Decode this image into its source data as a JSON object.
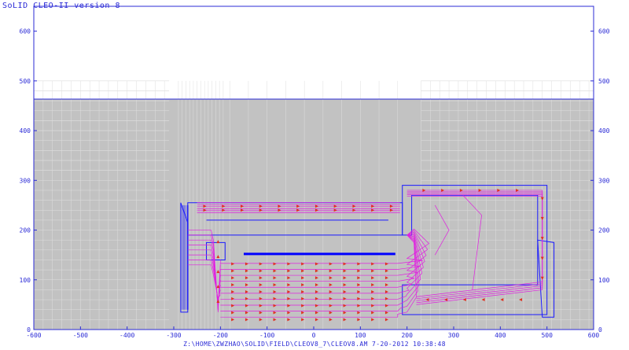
{
  "window": {
    "title": "SoLID CLEO-II version 8",
    "footer": "Z:\\HOME\\ZWZHAO\\SOLID\\FIELD\\CLEOV8_7\\CLEOV8.AM  7-20-2012  10:38:48"
  },
  "axes": {
    "x_ticks": [
      "-600",
      "-500",
      "-400",
      "-300",
      "-200",
      "-100",
      "0",
      "100",
      "200",
      "300",
      "400",
      "500",
      "600"
    ],
    "y_ticks": [
      "0",
      "100",
      "200",
      "300",
      "400",
      "500",
      "600"
    ],
    "xlim": [
      -600,
      600
    ],
    "ylim": [
      0,
      650
    ]
  },
  "colors": {
    "frame": "#2b2bd6",
    "mesh_bg": "#c2c2c2",
    "mesh_line": "#dedede",
    "field_line": "#e020e0",
    "field_arrow": "#e03020",
    "iron_outline": "#1a1aff"
  }
}
